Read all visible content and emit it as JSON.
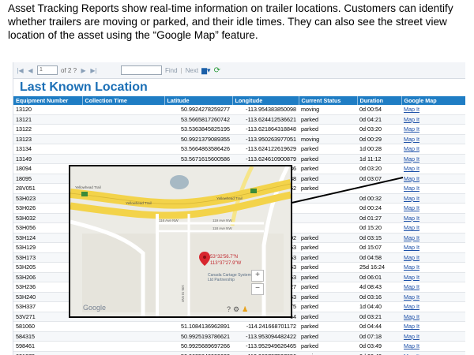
{
  "intro_text": "Asset Tracking Reports show real-time information on trailer locations.   Customers can identify whether trailers are moving or parked, and their idle times.   They can also see the street view location of the asset using the “Google Map” feature.",
  "toolbar": {
    "page_value": "1",
    "page_of": "of 2 ?",
    "find_label": "Find",
    "sep": "|",
    "next_label": "Next"
  },
  "report_title": "Last Known Location",
  "columns": [
    "Equipment Number",
    "Collection Time",
    "Latitude",
    "Longitude",
    "Current Status",
    "Duration",
    "Google Map"
  ],
  "rows": [
    [
      "13120",
      "",
      "50.9924278259277",
      "-113.954383850098",
      "moving",
      "0d 00:54",
      "Map It"
    ],
    [
      "13121",
      "",
      "53.5665817260742",
      "-113.624412536621",
      "parked",
      "0d 04:21",
      "Map It"
    ],
    [
      "13122",
      "",
      "53.5363845825195",
      "-113.621864318848",
      "parked",
      "0d 03:20",
      "Map It"
    ],
    [
      "13123",
      "",
      "50.9921379089355",
      "-113.950263977051",
      "moving",
      "0d 00:29",
      "Map It"
    ],
    [
      "13134",
      "",
      "53.5664863586426",
      "-113.624122619629",
      "parked",
      "1d 00:28",
      "Map It"
    ],
    [
      "13149",
      "",
      "53.5671615600586",
      "-113.624610900879",
      "parked",
      "1d 11:12",
      "Map It"
    ],
    [
      "18094",
      "",
      "",
      "86",
      "parked",
      "0d 03:20",
      "Map It"
    ],
    [
      "18095",
      "",
      "",
      "88",
      "parked",
      "0d 03:07",
      "Map It"
    ],
    [
      "28V051",
      "",
      "",
      "52",
      "parked",
      "",
      "Map It"
    ],
    [
      "53H023",
      "",
      "",
      "",
      "",
      "0d 00:32",
      "Map It"
    ],
    [
      "53H026",
      "",
      "",
      "",
      "",
      "0d 00:24",
      "Map It"
    ],
    [
      "53H032",
      "",
      "",
      "",
      "",
      "0d 01:27",
      "Map It"
    ],
    [
      "53H056",
      "",
      "",
      "",
      "",
      "0d 15:20",
      "Map It"
    ],
    [
      "53H124",
      "",
      "",
      "02",
      "parked",
      "0d 03:15",
      "Map It"
    ],
    [
      "53H129",
      "",
      "",
      "63",
      "parked",
      "0d 15:07",
      "Map It"
    ],
    [
      "53H173",
      "",
      "",
      "63",
      "parked",
      "0d 04:58",
      "Map It"
    ],
    [
      "53H205",
      "",
      "",
      "63",
      "parked",
      "25d 16:24",
      "Map It"
    ],
    [
      "53H206",
      "",
      "",
      "63",
      "parked",
      "0d 06:01",
      "Map It"
    ],
    [
      "53H236",
      "",
      "",
      "27",
      "parked",
      "4d 08:43",
      "Map It"
    ],
    [
      "53H240",
      "",
      "",
      "63",
      "parked",
      "0d 03:16",
      "Map It"
    ],
    [
      "53H337",
      "",
      "",
      "75",
      "parked",
      "1d 04:40",
      "Map It"
    ],
    [
      "53V271",
      "",
      "",
      "64",
      "parked",
      "0d 03:21",
      "Map It"
    ],
    [
      "581060",
      "",
      "51.1084136962891",
      "-114.241668701172",
      "parked",
      "0d 04:44",
      "Map It"
    ],
    [
      "584315",
      "",
      "50.9925193786621",
      "-113.953094482422",
      "parked",
      "0d 07:18",
      "Map It"
    ],
    [
      "598461",
      "",
      "50.9925689697266",
      "-113.952949626465",
      "parked",
      "0d 03:49",
      "Map It"
    ],
    [
      "621073",
      "",
      "50.9635848999023",
      "-113.969787597656",
      "moving",
      "0d 00:43",
      "Map It"
    ]
  ],
  "map": {
    "road_label_1": "Yellowhead Trail",
    "road_label_2": "Yellowhead Trail",
    "road_label_3": "Yellowhead Trail",
    "street_label_1": "119 Ave NW",
    "street_label_2": "118 Ave NW",
    "street_label_3": "116 Ave NW",
    "street_label_4": "105 St NW",
    "pin_lat": "53°32'56.7\"N",
    "pin_lon": "113°37'27.9\"W",
    "business_label": "Canada Cartage System Ltd Partnership",
    "google": "Google"
  },
  "colors": {
    "header_blue": "#1f7dc4",
    "title_blue": "#1b6fb6",
    "freeway_yellow": "#f3d34a",
    "pin_red": "#d8262e"
  }
}
